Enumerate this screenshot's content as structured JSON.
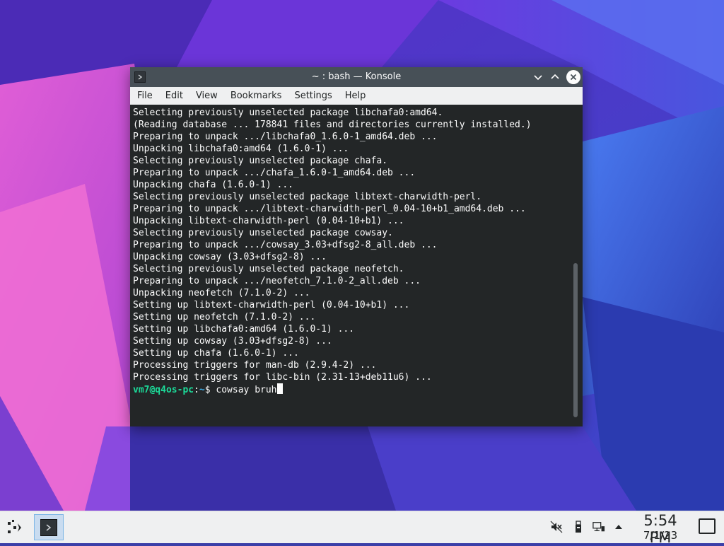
{
  "window": {
    "title": "~ : bash — Konsole"
  },
  "menubar": {
    "items": [
      "File",
      "Edit",
      "View",
      "Bookmarks",
      "Settings",
      "Help"
    ]
  },
  "terminal": {
    "lines": [
      "Selecting previously unselected package libchafa0:amd64.",
      "(Reading database ... 178841 files and directories currently installed.)",
      "Preparing to unpack .../libchafa0_1.6.0-1_amd64.deb ...",
      "Unpacking libchafa0:amd64 (1.6.0-1) ...",
      "Selecting previously unselected package chafa.",
      "Preparing to unpack .../chafa_1.6.0-1_amd64.deb ...",
      "Unpacking chafa (1.6.0-1) ...",
      "Selecting previously unselected package libtext-charwidth-perl.",
      "Preparing to unpack .../libtext-charwidth-perl_0.04-10+b1_amd64.deb ...",
      "Unpacking libtext-charwidth-perl (0.04-10+b1) ...",
      "Selecting previously unselected package cowsay.",
      "Preparing to unpack .../cowsay_3.03+dfsg2-8_all.deb ...",
      "Unpacking cowsay (3.03+dfsg2-8) ...",
      "Selecting previously unselected package neofetch.",
      "Preparing to unpack .../neofetch_7.1.0-2_all.deb ...",
      "Unpacking neofetch (7.1.0-2) ...",
      "Setting up libtext-charwidth-perl (0.04-10+b1) ...",
      "Setting up neofetch (7.1.0-2) ...",
      "Setting up libchafa0:amd64 (1.6.0-1) ...",
      "Setting up cowsay (3.03+dfsg2-8) ...",
      "Setting up chafa (1.6.0-1) ...",
      "Processing triggers for man-db (2.9.4-2) ...",
      "Processing triggers for libc-bin (2.31-13+deb11u6) ..."
    ],
    "prompt": {
      "user_host": "vm7@q4os-pc",
      "separator": ":",
      "path": "~",
      "symbol": "$ ",
      "command": "cowsay bruh"
    }
  },
  "panel": {
    "launcher_icon": "app-launcher-icon",
    "task_icon": "konsole-icon",
    "tray": [
      "audio-muted-icon",
      "usb-device-icon",
      "network-wired-icon",
      "tray-expand-arrow-icon"
    ],
    "clock_time": "5:54 PM",
    "clock_date": "7/1/23",
    "show_desktop_icon": "show-desktop-icon"
  },
  "colors": {
    "terminal_bg": "#232627",
    "terminal_fg": "#fcfcfc",
    "prompt_user": "#1cdc9a",
    "prompt_path": "#3daee9",
    "titlebar": "#475057",
    "panel_bg": "#eff0f1"
  }
}
